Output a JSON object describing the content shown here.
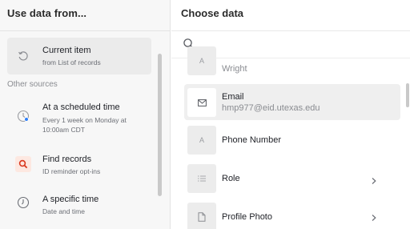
{
  "left_panel": {
    "title": "Use data from...",
    "current": {
      "title": "Current item",
      "subtitle": "from List of records",
      "icon": "refresh-icon"
    },
    "other_sources_label": "Other sources",
    "sources": [
      {
        "title": "At a scheduled time",
        "subtitle": "Every 1 week on Monday at 10:00am CDT",
        "icon": "clock-icon"
      },
      {
        "title": "Find records",
        "subtitle": "ID reminder opt-ins",
        "icon": "search-icon",
        "icon_color": "#d9381e"
      },
      {
        "title": "A specific time",
        "subtitle": "Date and time",
        "icon": "clock-icon"
      }
    ]
  },
  "right_panel": {
    "title": "Choose data",
    "search_placeholder": "",
    "fields": [
      {
        "label": "",
        "value": "Wright",
        "icon": "text-icon"
      },
      {
        "label": "Email",
        "value": "hmp977@eid.utexas.edu",
        "icon": "mail-icon",
        "highlighted": true
      },
      {
        "label": "Phone Number",
        "value": "",
        "icon": "text-icon"
      },
      {
        "label": "Role",
        "value": "",
        "icon": "list-icon",
        "has_children": true
      },
      {
        "label": "Profile Photo",
        "value": "",
        "icon": "file-icon",
        "has_children": true
      }
    ]
  }
}
